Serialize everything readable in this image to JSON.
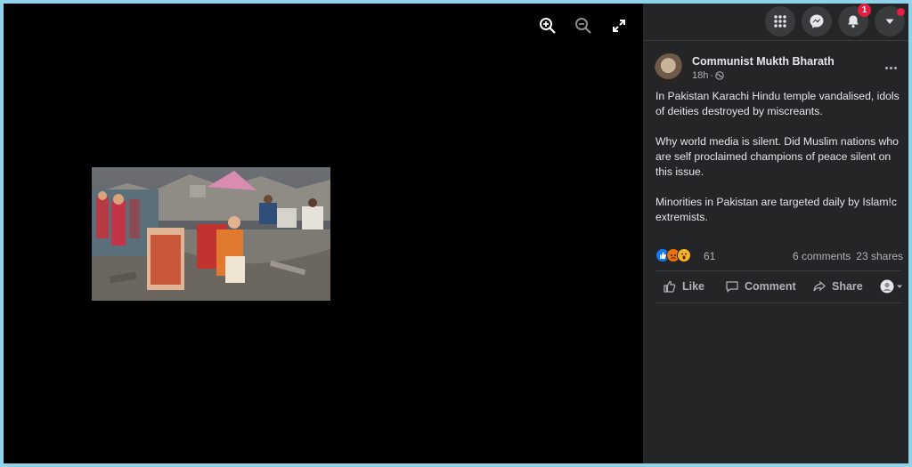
{
  "viewer": {
    "tools": [
      {
        "icon": "zoom-in-icon"
      },
      {
        "icon": "zoom-out-icon"
      },
      {
        "icon": "fullscreen-icon"
      }
    ]
  },
  "topnav": {
    "menu_icon": "grid-menu-icon",
    "messenger_icon": "messenger-icon",
    "notifications_icon": "bell-icon",
    "notifications_badge": "1",
    "account_icon": "caret-down-icon"
  },
  "post": {
    "author": "Communist Mukth Bharath",
    "time": "18h",
    "privacy_icon": "globe-icon",
    "paragraphs": [
      "In Pakistan Karachi Hindu temple vandalised, idols of deities destroyed by miscreants.",
      "Why world media is silent. Did Muslim nations who are self proclaimed champions of peace silent on this issue.",
      "Minorities in Pakistan are targeted daily by Islam!c extremists."
    ],
    "reaction_count": "61",
    "reaction_icons": [
      "like-reaction-icon",
      "angry-reaction-icon",
      "wow-reaction-icon"
    ],
    "comments": "6 comments",
    "shares": "23 shares",
    "actions": {
      "like": "Like",
      "comment": "Comment",
      "share": "Share"
    }
  },
  "colors": {
    "panel_bg": "#242526",
    "text_primary": "#e4e6eb",
    "text_secondary": "#b0b3b8",
    "badge": "#e41e3f",
    "like_blue": "#1877f2"
  }
}
